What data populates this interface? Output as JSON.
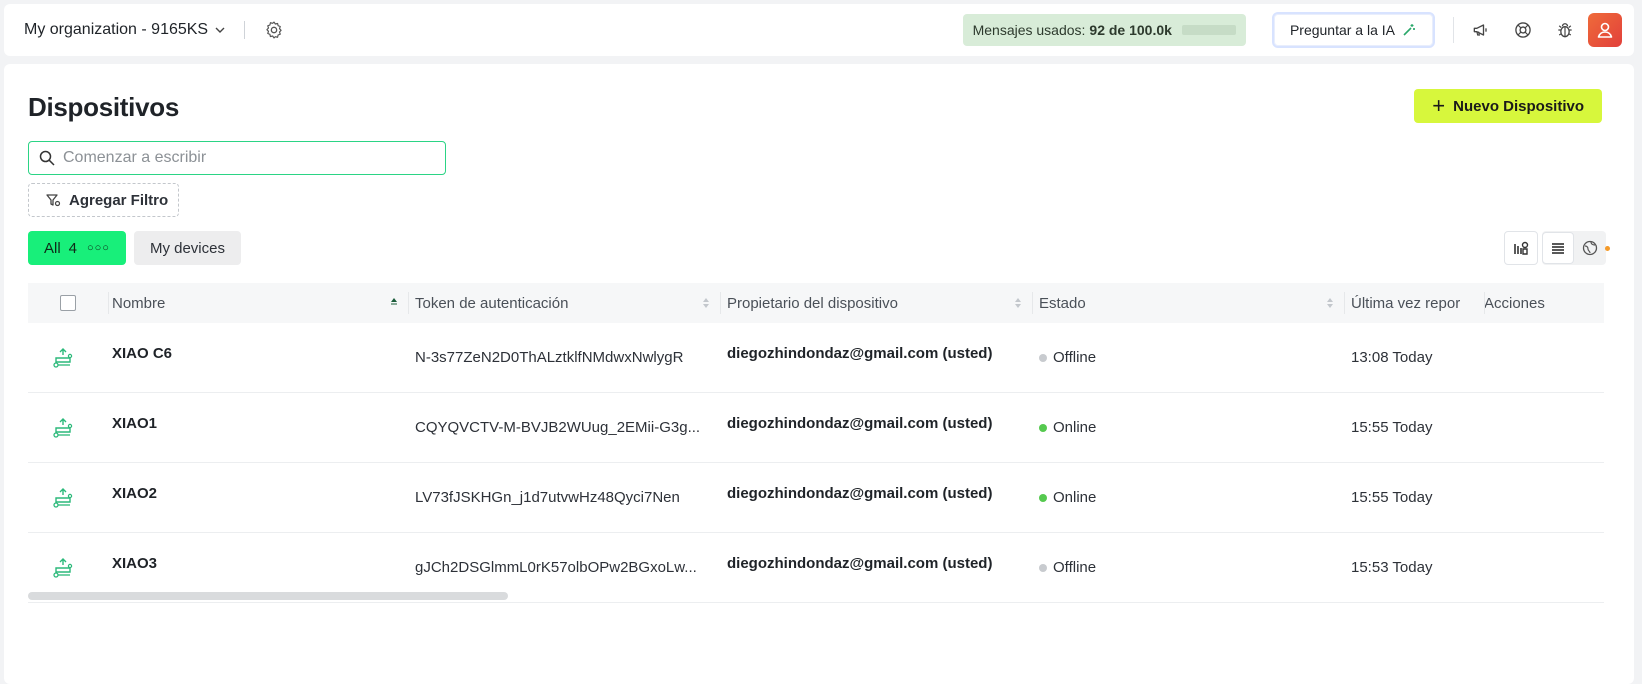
{
  "topbar": {
    "org_name": "My organization - 9165KS",
    "usage_label": "Mensajes usados:",
    "usage_value": "92 de 100.0k",
    "usage_fraction": 0.00092,
    "ask_ai_label": "Preguntar a la IA"
  },
  "page": {
    "title": "Dispositivos",
    "new_device_label": "Nuevo Dispositivo",
    "search_placeholder": "Comenzar a escribir",
    "add_filter_label": "Agregar Filtro"
  },
  "tabs": [
    {
      "label": "All",
      "count": "4",
      "active": true
    },
    {
      "label": "My devices",
      "active": false
    }
  ],
  "table": {
    "columns": {
      "name": "Nombre",
      "token": "Token de autenticación",
      "owner": "Propietario del dispositivo",
      "state": "Estado",
      "last": "Última vez repor",
      "actions": "Acciones"
    },
    "rows": [
      {
        "name": "XIAO C6",
        "token": "N-3s77ZeN2D0ThALztklfNMdwxNwlygR",
        "owner": "diegozhindondaz@gmail.com (usted)",
        "state": "Offline",
        "last": "13:08 Today"
      },
      {
        "name": "XIAO1",
        "token": "CQYQVCTV-M-BVJB2WUug_2EMii-G3g...",
        "owner": "diegozhindondaz@gmail.com (usted)",
        "state": "Online",
        "last": "15:55 Today"
      },
      {
        "name": "XIAO2",
        "token": "LV73fJSKHGn_j1d7utvwHz48Qyci7Nen",
        "owner": "diegozhindondaz@gmail.com (usted)",
        "state": "Online",
        "last": "15:55 Today"
      },
      {
        "name": "XIAO3",
        "token": "gJCh2DSGlmmL0rK57olbOPw2BGxoLw...",
        "owner": "diegozhindondaz@gmail.com (usted)",
        "state": "Offline",
        "last": "15:53 Today"
      }
    ]
  },
  "colors": {
    "accent_green": "#18ef7a",
    "new_button": "#d7f73c",
    "online": "#55c94f",
    "offline": "#c8cbcf",
    "device_icon": "#2bb97a"
  }
}
